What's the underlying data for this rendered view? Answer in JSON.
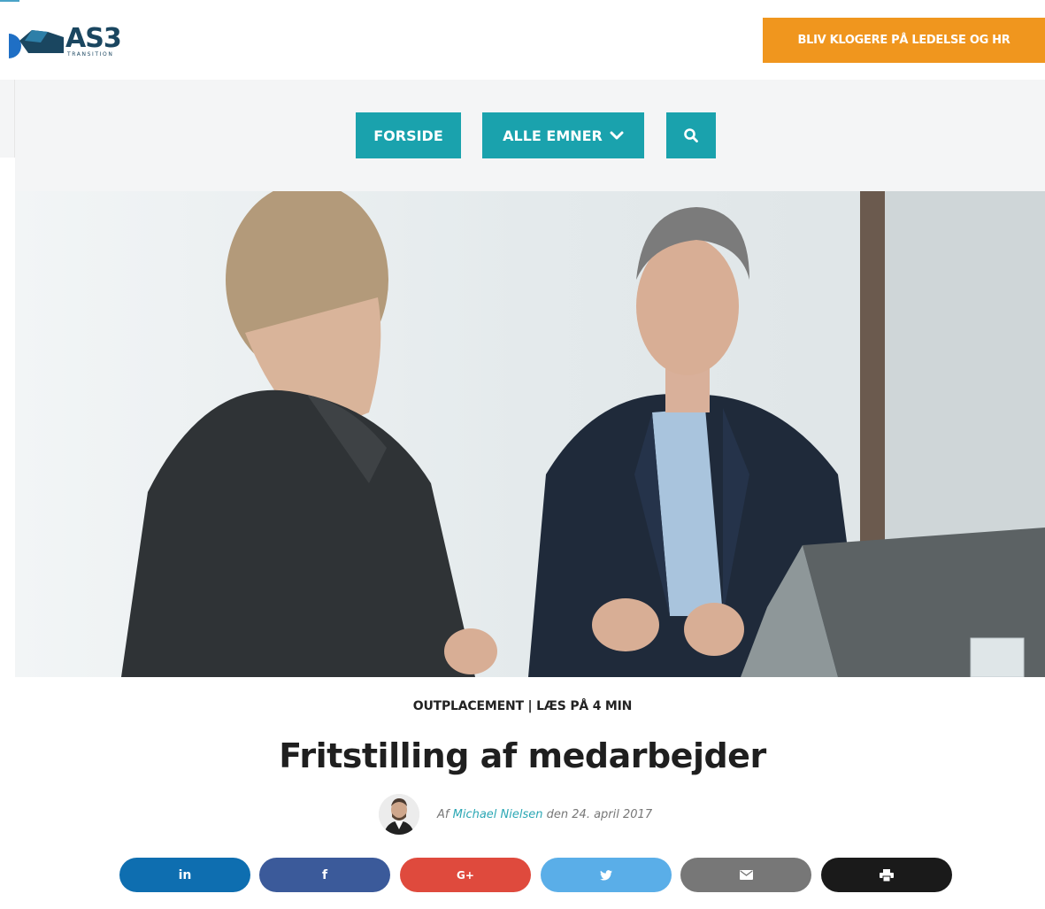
{
  "header": {
    "logo_text": "AS3",
    "logo_sub": "TRANSITION",
    "cta_label": "BLIV KLOGERE PÅ LEDELSE OG HR"
  },
  "nav": {
    "forside_label": "FORSIDE",
    "emner_label": "ALLE EMNER",
    "search_icon": "search-icon"
  },
  "article": {
    "meta": "OUTPLACEMENT | LÆS PÅ 4 MIN",
    "title": "Fritstilling af medarbejder",
    "byline_prefix": "Af",
    "author": "Michael Nielsen",
    "date_text": "den 24. april 2017"
  },
  "share": {
    "linkedin_label": "in",
    "facebook_label": "f",
    "google_label": "G+",
    "twitter_icon": "twitter-icon",
    "email_icon": "email-icon",
    "print_icon": "print-icon"
  },
  "colors": {
    "brand_teal": "#1aa2ad",
    "cta_orange": "#f0961e",
    "logo_navy": "#1a4660"
  }
}
